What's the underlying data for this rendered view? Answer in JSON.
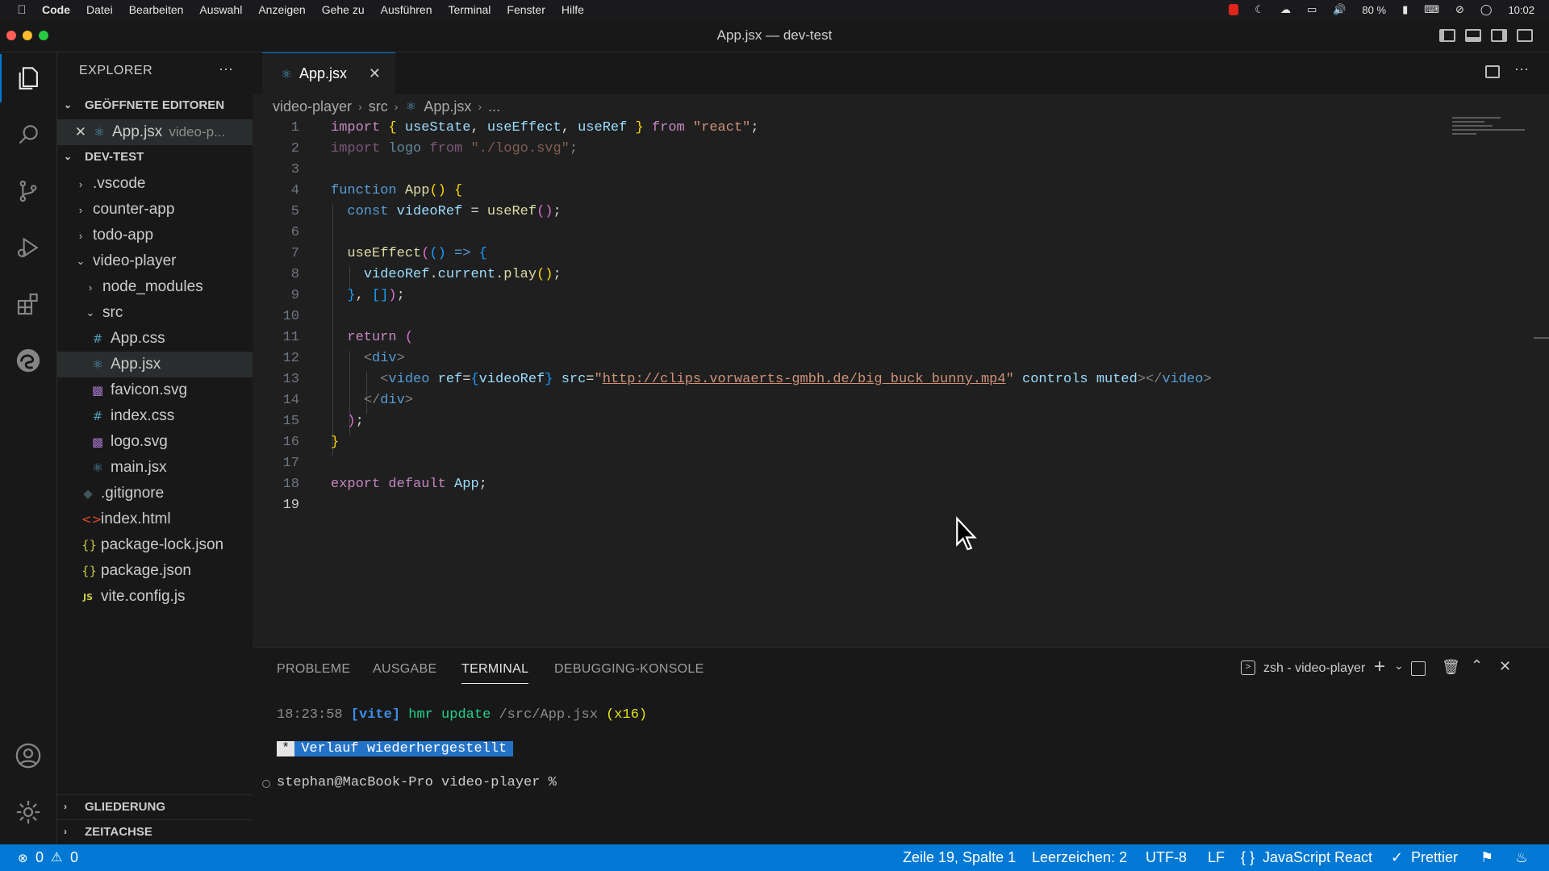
{
  "menubar": {
    "app": "Code",
    "items": [
      "Datei",
      "Bearbeiten",
      "Auswahl",
      "Anzeigen",
      "Gehe zu",
      "Ausführen",
      "Terminal",
      "Fenster",
      "Hilfe"
    ],
    "battery": "80 %",
    "clock": "10:02"
  },
  "window": {
    "title": "App.jsx — dev-test"
  },
  "sidebar": {
    "title": "EXPLORER",
    "more": "···",
    "open_editors": {
      "header": "GEÖFFNETE EDITOREN",
      "item": {
        "name": "App.jsx",
        "path": "video-p..."
      }
    },
    "workspace": {
      "header": "DEV-TEST",
      "folders": {
        "vscode": ".vscode",
        "counter": "counter-app",
        "todo": "todo-app",
        "video": "video-player",
        "node_modules": "node_modules",
        "src": "src"
      },
      "files": {
        "app_css": "App.css",
        "app_jsx": "App.jsx",
        "favicon": "favicon.svg",
        "index_css": "index.css",
        "logo": "logo.svg",
        "main": "main.jsx",
        "gitignore": ".gitignore",
        "index_html": "index.html",
        "package_lock": "package-lock.json",
        "package": "package.json",
        "vite": "vite.config.js"
      }
    },
    "outline": "GLIEDERUNG",
    "timeline": "ZEITACHSE"
  },
  "editor": {
    "tab": "App.jsx",
    "breadcrumb": [
      "video-player",
      "src",
      "App.jsx",
      "..."
    ],
    "line_numbers": [
      "1",
      "2",
      "3",
      "4",
      "5",
      "6",
      "7",
      "8",
      "9",
      "10",
      "11",
      "12",
      "13",
      "14",
      "15",
      "16",
      "17",
      "18",
      "19"
    ],
    "code": {
      "l1": {
        "t1": "import",
        "t2": "{",
        "t3": "useState",
        "t4": "useEffect",
        "t5": "useRef",
        "t6": "}",
        "t7": "from",
        "t8": "\"react\""
      },
      "l2": {
        "t1": "import",
        "t2": "logo",
        "t3": "from",
        "t4": "\"./logo.svg\""
      },
      "l4": {
        "t1": "function",
        "t2": "App",
        "t3": "()",
        "t4": "{"
      },
      "l5": {
        "t1": "const",
        "t2": "videoRef",
        "t3": "useRef",
        "t4": "()"
      },
      "l7": {
        "t1": "useEffect",
        "t2": "(",
        "t3": "()",
        "t4": "=>",
        "t5": "{"
      },
      "l8": {
        "t1": "videoRef",
        "t2": "current",
        "t3": "play",
        "t4": "()"
      },
      "l9": {
        "t1": "}",
        "t2": "[]",
        "t3": ")"
      },
      "l11": {
        "t1": "return",
        "t2": "("
      },
      "l12": {
        "t1": "<",
        "t2": "div",
        "t3": ">"
      },
      "l13": {
        "t1": "<",
        "t2": "video",
        "t3": "ref",
        "t4": "{",
        "t5": "videoRef",
        "t6": "}",
        "t7": "src",
        "t8": "http://clips.vorwaerts-gmbh.de/big_buck_bunny.mp4",
        "t9": "controls",
        "t10": "muted",
        "t11": "></",
        "t12": "video",
        "t13": ">"
      },
      "l14": {
        "t1": "</",
        "t2": "div",
        "t3": ">"
      },
      "l15": {
        "t1": ")"
      },
      "l16": {
        "t1": "}"
      },
      "l18": {
        "t1": "export",
        "t2": "default",
        "t3": "App"
      }
    }
  },
  "panel": {
    "tabs": [
      "PROBLEME",
      "AUSGABE",
      "TERMINAL",
      "DEBUGGING-KONSOLE"
    ],
    "shell": "zsh - video-player",
    "terminal": {
      "time": "18:23:58",
      "vite": "[vite]",
      "msg": "hmr update",
      "path": "/src/App.jsx",
      "count": "(x16)",
      "restored_star": "*",
      "restored": "Verlauf wiederhergestellt",
      "prompt": "stephan@MacBook-Pro video-player %"
    }
  },
  "statusbar": {
    "errors": "0",
    "warnings": "0",
    "position": "Zeile 19, Spalte 1",
    "indent": "Leerzeichen: 2",
    "encoding": "UTF-8",
    "eol": "LF",
    "language": "JavaScript React",
    "formatter": "Prettier"
  },
  "colors": {
    "accent": "#0078d4",
    "background": "#1f1f1f",
    "sidebar": "#181818"
  }
}
